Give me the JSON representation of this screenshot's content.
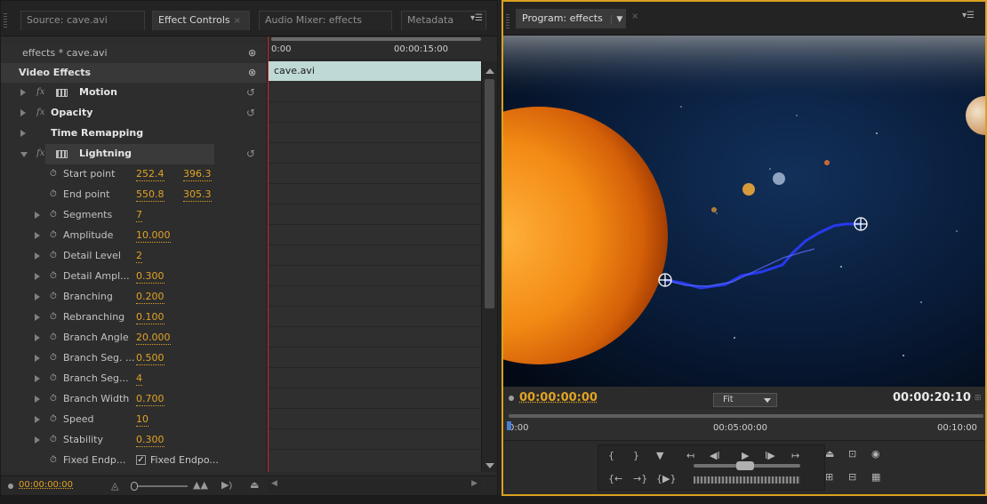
{
  "left_tabs": [
    {
      "label": "Source: cave.avi"
    },
    {
      "label": "Effect Controls"
    },
    {
      "label": "Audio Mixer: effects"
    },
    {
      "label": "Metadata"
    }
  ],
  "source_label": "effects * cave.avi",
  "video_effects_label": "Video Effects",
  "effects": {
    "motion": "Motion",
    "opacity": "Opacity",
    "time_remapping": "Time Remapping",
    "lightning": "Lightning"
  },
  "params": [
    {
      "name": "Start point",
      "values": [
        "252.4",
        "396.3"
      ]
    },
    {
      "name": "End point",
      "values": [
        "550.8",
        "305.3"
      ]
    },
    {
      "name": "Segments",
      "values": [
        "7"
      ]
    },
    {
      "name": "Amplitude",
      "values": [
        "10.000"
      ]
    },
    {
      "name": "Detail Level",
      "values": [
        "2"
      ]
    },
    {
      "name": "Detail Ampl...",
      "values": [
        "0.300"
      ]
    },
    {
      "name": "Branching",
      "values": [
        "0.200"
      ]
    },
    {
      "name": "Rebranching",
      "values": [
        "0.100"
      ]
    },
    {
      "name": "Branch Angle",
      "values": [
        "20.000"
      ]
    },
    {
      "name": "Branch Seg. ...",
      "values": [
        "0.500"
      ]
    },
    {
      "name": "Branch Seg...",
      "values": [
        "4"
      ]
    },
    {
      "name": "Branch Width",
      "values": [
        "0.700"
      ]
    },
    {
      "name": "Speed",
      "values": [
        "10"
      ]
    },
    {
      "name": "Stability",
      "values": [
        "0.300"
      ]
    },
    {
      "name": "Fixed Endp...",
      "checkbox_label": "Fixed Endpo..."
    }
  ],
  "timeline": {
    "start": "0:00",
    "end": "00:00:15:00",
    "clip": "cave.avi"
  },
  "left_footer_tc": "00:00:00:00",
  "program_tab": "Program: effects",
  "program": {
    "current_tc": "00:00:00:00",
    "fit": "Fit",
    "duration_tc": "00:00:20:10",
    "ruler": [
      "0:00",
      "00:05:00:00",
      "00:10:00"
    ]
  },
  "colors": {
    "accent_timecode": "#e0a326",
    "panel_focus_border": "#d9a21e",
    "clip_bar": "#bfd9d6",
    "playhead": "#d12b2b"
  }
}
